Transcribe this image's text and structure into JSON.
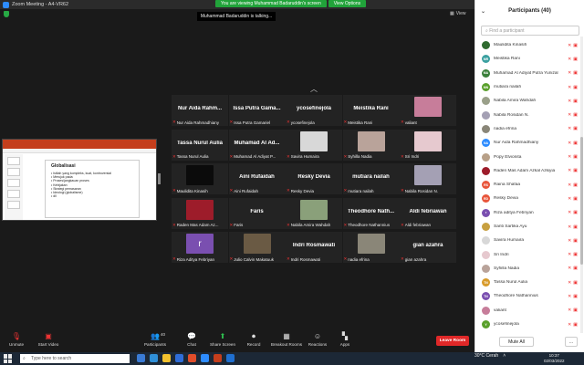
{
  "window": {
    "title": "Zoom Meeting - A4-VR62"
  },
  "share_banner": {
    "message": "You are viewing Muhammad Badaruddin's screen",
    "options": "View Options"
  },
  "view_button": "View",
  "talking": "Muhammad Badaruddin is talking...",
  "slide": {
    "heading": "Globalisasi",
    "lines": [
      "• Istilah yang kompleks, kuat, kontroversial",
      "• Merujuk pada:",
      "  • Proses/jangkauan proses",
      "  • Kebijakan",
      "  • Strategi pemasaran",
      "  • Ideologi (globalisme)",
      "  • dll"
    ]
  },
  "gallery": [
    {
      "name": "Nur Aida Rahm...",
      "label": "Nur Aida Rahmadhiany",
      "kind": "name"
    },
    {
      "name": "Issa Putra Gama...",
      "label": "Issa Putra Gamariel",
      "kind": "name"
    },
    {
      "name": "ycosefinejola",
      "label": "ycosefinejola",
      "kind": "name"
    },
    {
      "name": "Meistika Rani",
      "label": "Meistika Rani",
      "kind": "name"
    },
    {
      "name": "",
      "label": "valiant",
      "kind": "photo",
      "color": "#c77d9a"
    },
    {
      "name": "Tassa Nurul Aulia",
      "label": "Tassa Nurul Aulia",
      "kind": "name"
    },
    {
      "name": "Muhamad Al Ad...",
      "label": "Muhamad Al Adiyat P...",
      "kind": "name"
    },
    {
      "name": "",
      "label": "Savira Humaira",
      "kind": "photo",
      "color": "#d8d8d8"
    },
    {
      "name": "",
      "label": "Syhilla Nadia",
      "kind": "photo",
      "color": "#b9a39a"
    },
    {
      "name": "",
      "label": "Sri Indri",
      "kind": "photo",
      "color": "#e6c9cf"
    },
    {
      "name": "",
      "label": "Maulidita Kinasih",
      "kind": "photo",
      "color": "#0b0b0b"
    },
    {
      "name": "Aini Rufaidah",
      "label": "Aini Rufaidah",
      "kind": "name"
    },
    {
      "name": "Resky Devia",
      "label": "Resky Devia",
      "kind": "name"
    },
    {
      "name": "mutiara nailah",
      "label": "mutiara nailah",
      "kind": "name"
    },
    {
      "name": "",
      "label": "Nabila Rosidan N.",
      "kind": "photo",
      "color": "#a4a0b4"
    },
    {
      "name": "",
      "label": "Raden Mas Adam Az...",
      "kind": "photo",
      "color": "#9d1c2a"
    },
    {
      "name": "Faris",
      "label": "Faris",
      "kind": "name"
    },
    {
      "name": "",
      "label": "Nabila Amira Wahdah",
      "kind": "photo",
      "color": "#8aa07a"
    },
    {
      "name": "Theodhore Nath...",
      "label": "Theodhore Nathannius",
      "kind": "name"
    },
    {
      "name": "Aldi febriawan",
      "label": "Aldi febriawan",
      "kind": "name"
    },
    {
      "name": "r",
      "label": "Riza Aditya Febriyan",
      "kind": "letter",
      "color": "#7a4fb0"
    },
    {
      "name": "",
      "label": "Julio Calvin Makatuuk",
      "kind": "photo",
      "color": "#6a5a44"
    },
    {
      "name": "Indri Rosmawati",
      "label": "Indri Rosmawati",
      "kind": "name"
    },
    {
      "name": "",
      "label": "nadia efrina",
      "kind": "photo",
      "color": "#8a8678"
    },
    {
      "name": "gian azahra",
      "label": "gian azahra",
      "kind": "name"
    }
  ],
  "participants": {
    "header": "Participants (40)",
    "search_placeholder": "Find a participant",
    "list": [
      {
        "name": "Maulidita Kinasih",
        "initials": "",
        "color": "#2f6b2f"
      },
      {
        "name": "Meistika Rani",
        "initials": "MR",
        "color": "#3ba0a0"
      },
      {
        "name": "Muhamad Al Adiyat Putra Yunizal",
        "initials": "MA",
        "color": "#3a7f3a"
      },
      {
        "name": "mutiara nailah",
        "initials": "MN",
        "color": "#5aa02c"
      },
      {
        "name": "Nabila Amira Wahdah",
        "initials": "",
        "color": "#9aa08a"
      },
      {
        "name": "Nabila Rosidan N.",
        "initials": "",
        "color": "#a4a0b4"
      },
      {
        "name": "nadia efrina",
        "initials": "",
        "color": "#8a8678"
      },
      {
        "name": "Nur Aida Rahmadhiany",
        "initials": "NA",
        "color": "#2d8cff"
      },
      {
        "name": "Popy Elvionita",
        "initials": "",
        "color": "#b8a088"
      },
      {
        "name": "Raden Mas Adam Azkal Azkiyia",
        "initials": "",
        "color": "#9d1c2a"
      },
      {
        "name": "Raina Shafaa",
        "initials": "RS",
        "color": "#e8553a"
      },
      {
        "name": "Resky Devia",
        "initials": "RD",
        "color": "#e8553a"
      },
      {
        "name": "Riza aditya Febriyan",
        "initials": "r",
        "color": "#7a4fb0"
      },
      {
        "name": "Santi Sartika Ayu",
        "initials": "",
        "color": "#c8a040"
      },
      {
        "name": "Savira Humaira",
        "initials": "",
        "color": "#d8d8d8"
      },
      {
        "name": "Sri Indri",
        "initials": "",
        "color": "#e6c9cf"
      },
      {
        "name": "Syhilla Nadia",
        "initials": "",
        "color": "#b9a39a"
      },
      {
        "name": "Tassa Nurul Aulia",
        "initials": "TN",
        "color": "#d89b2a"
      },
      {
        "name": "Theodhore Nathannius",
        "initials": "TN",
        "color": "#7a4fb0"
      },
      {
        "name": "valiant",
        "initials": "",
        "color": "#c77d9a"
      },
      {
        "name": "ycosefinejola",
        "initials": "Y",
        "color": "#5aa02c"
      }
    ],
    "mute_all": "Mute All",
    "more": "..."
  },
  "toolbar": {
    "unmute": "Unmute",
    "start_video": "Start Video",
    "participants": "Participants",
    "participants_count": "40",
    "chat": "Chat",
    "share_screen": "Share Screen",
    "record": "Record",
    "breakout": "Breakout Rooms",
    "reactions": "Reactions",
    "apps": "Apps",
    "leave": "Leave Room"
  },
  "taskbar": {
    "search": "Type here to search",
    "weather": "30°C  Cerah",
    "time": "10:37",
    "date": "02/03/2022"
  }
}
